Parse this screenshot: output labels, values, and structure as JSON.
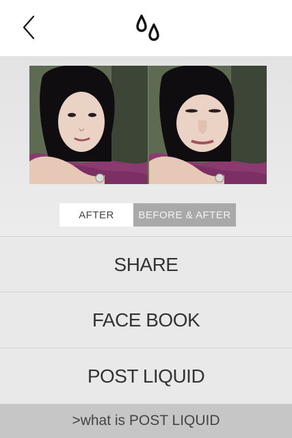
{
  "header": {
    "back_icon": "chevron-left-icon",
    "logo_icon": "water-drops-icon"
  },
  "toggle": {
    "after_label": "AFTER",
    "before_after_label": "BEFORE & AFTER",
    "selected": "AFTER"
  },
  "menu": {
    "share_label": "SHARE",
    "facebook_label": "FACE BOOK",
    "post_liquid_label": "POST LIQUID"
  },
  "footer": {
    "info_label": ">what is POST LIQUID"
  }
}
